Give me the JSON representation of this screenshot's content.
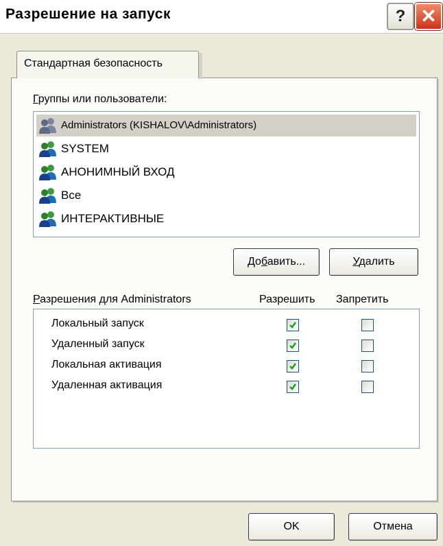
{
  "window": {
    "title": "Разрешение на запуск",
    "help_glyph": "?",
    "close_glyph": "✕"
  },
  "tabs": [
    {
      "label": "Стандартная безопасность",
      "active": true
    }
  ],
  "groups": {
    "label_accel": "Г",
    "label_rest": "руппы или пользователи:",
    "items": [
      {
        "name": "Administrators (KISHALOV\\Administrators)",
        "icon": "user-group-icon",
        "selected": true
      },
      {
        "name": "SYSTEM",
        "icon": "user-group-icon",
        "selected": false
      },
      {
        "name": "АНОНИМНЫЙ ВХОД",
        "icon": "user-group-icon",
        "selected": false
      },
      {
        "name": "Все",
        "icon": "user-group-icon",
        "selected": false
      },
      {
        "name": "ИНТЕРАКТИВНЫЕ",
        "icon": "user-group-icon",
        "selected": false
      }
    ]
  },
  "buttons": {
    "add_pre": "До",
    "add_accel": "б",
    "add_post": "авить...",
    "remove_accel": "У",
    "remove_post": "далить",
    "ok": "OK",
    "cancel": "Отмена"
  },
  "permissions": {
    "label_accel": "Р",
    "label_rest": "азрешения для Administrators",
    "allow_header": "Разрешить",
    "deny_header": "Запретить",
    "rows": [
      {
        "name": "Локальный запуск",
        "allow": true,
        "deny": false
      },
      {
        "name": "Удаленный запуск",
        "allow": true,
        "deny": false
      },
      {
        "name": "Локальная активация",
        "allow": true,
        "deny": false
      },
      {
        "name": "Удаленная активация",
        "allow": true,
        "deny": false
      }
    ]
  },
  "colors": {
    "check": "#21a121",
    "selection": "#d4d0c8",
    "close_button": "#c8331a"
  }
}
